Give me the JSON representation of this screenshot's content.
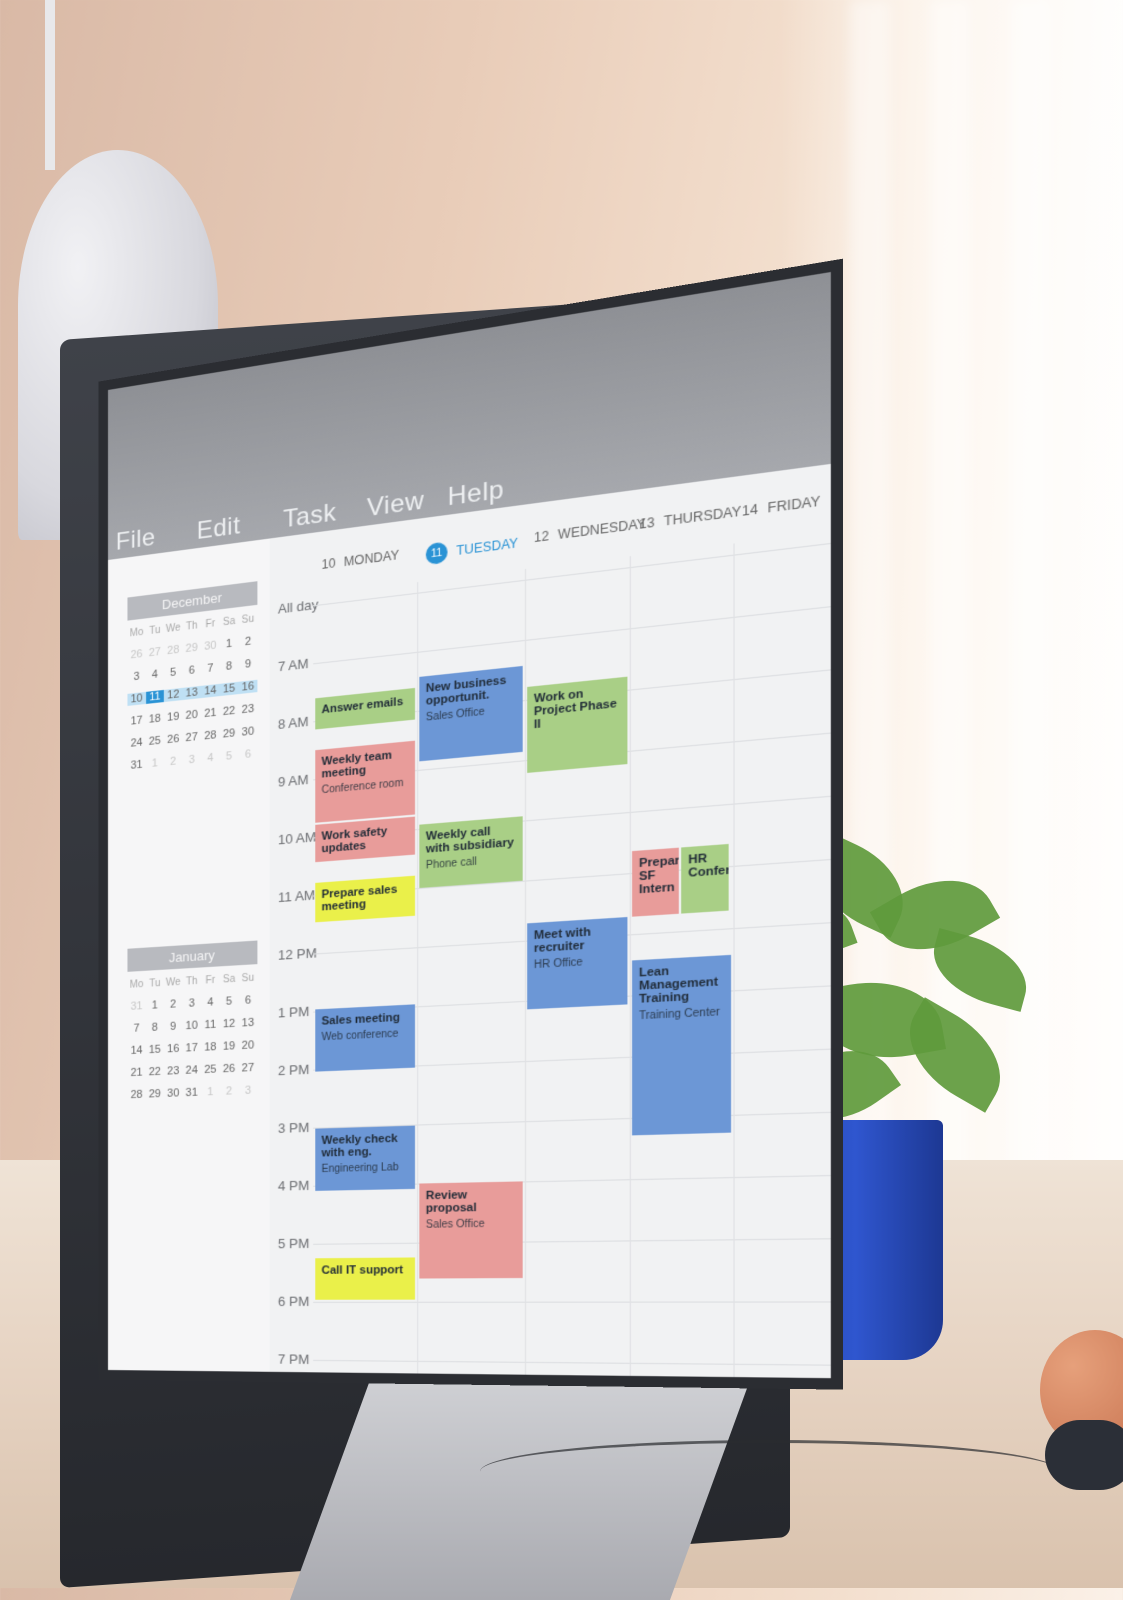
{
  "menu": [
    "File",
    "Edit",
    "Task",
    "View",
    "Help"
  ],
  "sidebar": {
    "dec": {
      "title": "December",
      "dow": [
        "Mo",
        "Tu",
        "We",
        "Th",
        "Fr",
        "Sa",
        "Su"
      ],
      "rows": [
        [
          "26",
          "27",
          "28",
          "29",
          "30",
          "1",
          "2"
        ],
        [
          "3",
          "4",
          "5",
          "6",
          "7",
          "8",
          "9"
        ],
        [
          "10",
          "11",
          "12",
          "13",
          "14",
          "15",
          "16"
        ],
        [
          "17",
          "18",
          "19",
          "20",
          "21",
          "22",
          "23"
        ],
        [
          "24",
          "25",
          "26",
          "27",
          "28",
          "29",
          "30"
        ],
        [
          "31",
          "1",
          "2",
          "3",
          "4",
          "5",
          "6"
        ]
      ]
    },
    "jan": {
      "title": "January",
      "dow": [
        "Mo",
        "Tu",
        "We",
        "Th",
        "Fr",
        "Sa",
        "Su"
      ],
      "rows": [
        [
          "31",
          "1",
          "2",
          "3",
          "4",
          "5",
          "6"
        ],
        [
          "7",
          "8",
          "9",
          "10",
          "11",
          "12",
          "13"
        ],
        [
          "14",
          "15",
          "16",
          "17",
          "18",
          "19",
          "20"
        ],
        [
          "21",
          "22",
          "23",
          "24",
          "25",
          "26",
          "27"
        ],
        [
          "28",
          "29",
          "30",
          "31",
          "1",
          "2",
          "3"
        ]
      ]
    }
  },
  "days": [
    {
      "num": "10",
      "label": "MONDAY"
    },
    {
      "num": "11",
      "label": "TUESDAY"
    },
    {
      "num": "12",
      "label": "WEDNESDAY"
    },
    {
      "num": "13",
      "label": "THURSDAY"
    },
    {
      "num": "14",
      "label": "FRIDAY"
    }
  ],
  "times": [
    "All day",
    "7 AM",
    "8 AM",
    "9 AM",
    "10 AM",
    "11 AM",
    "12 PM",
    "1 PM",
    "2 PM",
    "3 PM",
    "4 PM",
    "5 PM",
    "6 PM",
    "7 PM"
  ],
  "events": [
    {
      "t": "Answer emails",
      "s": "",
      "c": "green"
    },
    {
      "t": "Weekly team meeting",
      "s": "Conference room",
      "c": "red"
    },
    {
      "t": "Work safety updates",
      "s": "",
      "c": "red"
    },
    {
      "t": "Prepare sales meeting",
      "s": "",
      "c": "yellow"
    },
    {
      "t": "Sales meeting",
      "s": "Web conference",
      "c": "blue"
    },
    {
      "t": "Weekly check with eng.",
      "s": "Engineering Lab",
      "c": "blue"
    },
    {
      "t": "Call IT support",
      "s": "",
      "c": "yellow"
    },
    {
      "t": "New business opportunit.",
      "s": "Sales Office",
      "c": "blue"
    },
    {
      "t": "Weekly call with subsidiary",
      "s": "Phone call",
      "c": "green"
    },
    {
      "t": "Review proposal",
      "s": "Sales Office",
      "c": "red"
    },
    {
      "t": "Work on Project Phase II",
      "s": "",
      "c": "green"
    },
    {
      "t": "Meet with recruiter",
      "s": "HR Office",
      "c": "blue"
    },
    {
      "t": "Prepare SF Intern",
      "s": "",
      "c": "red"
    },
    {
      "t": "HR Conference",
      "s": "",
      "c": "green"
    },
    {
      "t": "Lean Management Training",
      "s": "Training Center",
      "c": "blue"
    }
  ]
}
